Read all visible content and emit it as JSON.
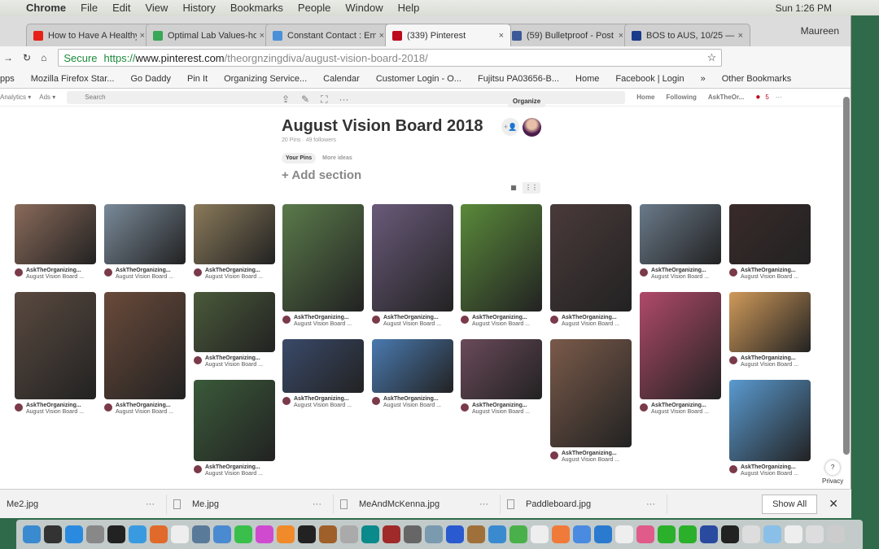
{
  "menubar": {
    "app": "Chrome",
    "items": [
      "File",
      "Edit",
      "View",
      "History",
      "Bookmarks",
      "People",
      "Window",
      "Help"
    ],
    "clock": "Sun 1:26 PM"
  },
  "tabs": [
    {
      "title": "How to Have A Healthy",
      "color": "#e62117"
    },
    {
      "title": "Optimal Lab Values-ho",
      "color": "#3aa657"
    },
    {
      "title": "Constant Contact : Em",
      "color": "#4a90d9"
    },
    {
      "title": "(339) Pinterest",
      "color": "#bd081c",
      "active": true
    },
    {
      "title": "(59) Bulletproof - Post",
      "color": "#3b5998"
    },
    {
      "title": "BOS to AUS, 10/25 —",
      "color": "#1a3a8a"
    }
  ],
  "user": "Maureen",
  "address": {
    "secure": "Secure",
    "scheme": "https://",
    "host": "www.pinterest.com",
    "path": "/theorgnzingdiva/august-vision-board-2018/"
  },
  "bookmarks": [
    "pps",
    "Mozilla Firefox Star...",
    "Go Daddy",
    "Pin It",
    "Organizing Service...",
    "Calendar",
    "Customer Login - O...",
    "Fujitsu PA03656-B...",
    "Home",
    "Facebook | Login",
    "»",
    "Other Bookmarks"
  ],
  "pinterest": {
    "analytics": "Analytics ▾",
    "ads": "Ads ▾",
    "search_placeholder": "Search",
    "nav": [
      "Home",
      "Following",
      "AskTheOr..."
    ],
    "notif_count": "5"
  },
  "board": {
    "title": "August Vision Board 2018",
    "meta": "20 Pins · 49 followers",
    "organize": "Organize",
    "tabs": [
      "Your Pins",
      "More ideas"
    ],
    "add_section": "+ Add section"
  },
  "pins": [
    [
      {
        "a": "AskTheOrganizing...",
        "b": "August Vision Board ..."
      },
      {
        "a": "AskTheOrganizing...",
        "b": "August Vision Board ..."
      }
    ],
    [
      {
        "a": "AskTheOrganizing...",
        "b": "August Vision Board ..."
      },
      {
        "a": "AskTheOrganizing...",
        "b": "August Vision Board ..."
      }
    ],
    [
      {
        "a": "AskTheOrganizing...",
        "b": "August Vision Board ..."
      },
      {
        "a": "AskTheOrganizing...",
        "b": "August Vision Board ..."
      },
      {
        "a": "AskTheOrganizing...",
        "b": "August Vision Board ..."
      }
    ],
    [
      {
        "a": "AskTheOrganizing...",
        "b": "August Vision Board ..."
      },
      {
        "a": "AskTheOrganizing...",
        "b": "August Vision Board ..."
      }
    ],
    [
      {
        "a": "AskTheOrganizing...",
        "b": "August Vision Board ..."
      },
      {
        "a": "AskTheOrganizing...",
        "b": "August Vision Board ..."
      }
    ],
    [
      {
        "a": "AskTheOrganizing...",
        "b": "August Vision Board ..."
      },
      {
        "a": "AskTheOrganizing...",
        "b": "August Vision Board ..."
      }
    ],
    [
      {
        "a": "AskTheOrganizing...",
        "b": "August Vision Board ..."
      },
      {
        "a": "AskTheOrganizing...",
        "b": "August Vision Board ..."
      }
    ],
    [
      {
        "a": "AskTheOrganizing...",
        "b": "August Vision Board ..."
      },
      {
        "a": "AskTheOrganizing...",
        "b": "August Vision Board ..."
      }
    ],
    [
      {
        "a": "AskTheOrganizing...",
        "b": "August Vision Board ..."
      },
      {
        "a": "AskTheOrganizing...",
        "b": "August Vision Board ..."
      },
      {
        "a": "AskTheOrganizing...",
        "b": "August Vision Board ..."
      }
    ]
  ],
  "help": "?",
  "privacy": "Privacy",
  "downloads": [
    "Me2.jpg",
    "Me.jpg",
    "MeAndMcKenna.jpg",
    "Paddleboard.jpg"
  ],
  "download_more": "···",
  "show_all": "Show All",
  "close": "✕"
}
